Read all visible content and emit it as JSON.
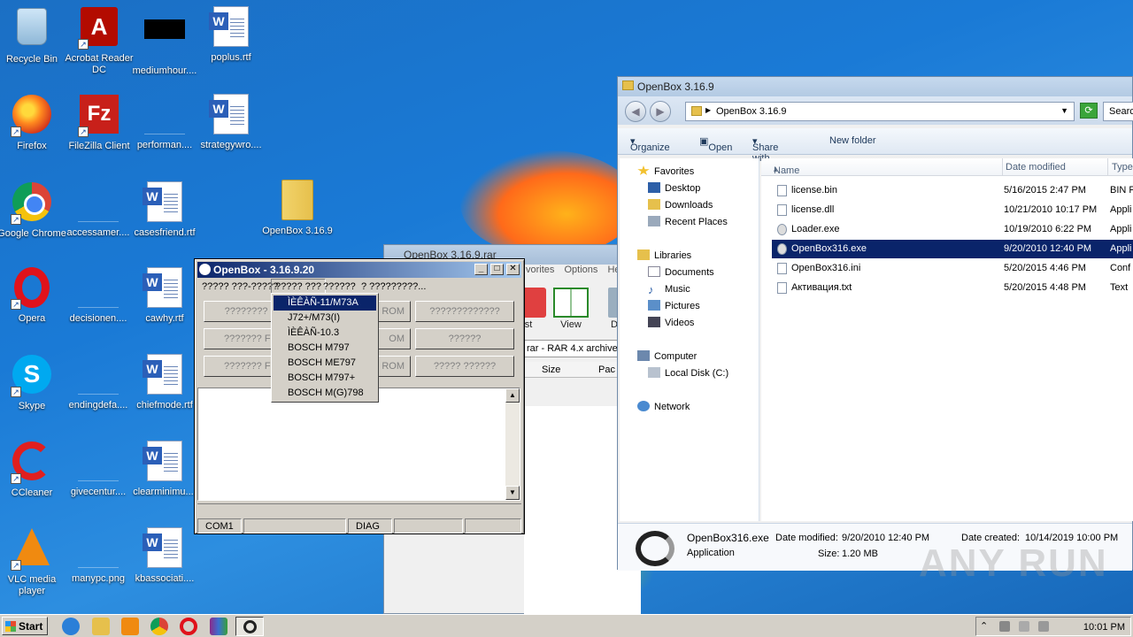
{
  "desktop": {
    "icons": [
      {
        "label": "Recycle Bin",
        "icon": "recycle-bin-icon"
      },
      {
        "label": "Acrobat Reader DC",
        "icon": "acrobat-icon"
      },
      {
        "label": "mediumhour....",
        "icon": "file-icon"
      },
      {
        "label": "poplus.rtf",
        "icon": "word-document-icon"
      },
      {
        "label": "Firefox",
        "icon": "firefox-icon"
      },
      {
        "label": "FileZilla Client",
        "icon": "filezilla-icon"
      },
      {
        "label": "performan....",
        "icon": "file-icon"
      },
      {
        "label": "strategywro....",
        "icon": "word-document-icon"
      },
      {
        "label": "Google Chrome",
        "icon": "chrome-icon"
      },
      {
        "label": "accessamer....",
        "icon": "file-icon"
      },
      {
        "label": "casesfriend.rtf",
        "icon": "word-document-icon"
      },
      {
        "label": "OpenBox 3.16.9",
        "icon": "folder-icon"
      },
      {
        "label": "Opera",
        "icon": "opera-icon"
      },
      {
        "label": "decisionen....",
        "icon": "file-icon"
      },
      {
        "label": "cawhy.rtf",
        "icon": "word-document-icon"
      },
      {
        "label": "Skype",
        "icon": "skype-icon"
      },
      {
        "label": "endingdefa....",
        "icon": "file-icon"
      },
      {
        "label": "chiefmode.rtf",
        "icon": "word-document-icon"
      },
      {
        "label": "CCleaner",
        "icon": "ccleaner-icon"
      },
      {
        "label": "givecentur....",
        "icon": "file-icon"
      },
      {
        "label": "clearminimu....",
        "icon": "word-document-icon"
      },
      {
        "label": "VLC media player",
        "icon": "vlc-icon"
      },
      {
        "label": "manypc.png",
        "icon": "file-icon"
      },
      {
        "label": "kbassociati....",
        "icon": "word-document-icon"
      }
    ]
  },
  "rar": {
    "title": "OpenBox 3.16.9.rar",
    "menu": [
      "vorites",
      "Options",
      "Help"
    ],
    "toolbar": [
      "st",
      "View",
      "De"
    ],
    "address": "rar - RAR 4.x archive",
    "columns": [
      "Size",
      "Pac"
    ]
  },
  "openbox": {
    "title": "OpenBox - 3.16.9.20",
    "menu": [
      "????? ???-?????",
      "????? ???",
      "??????",
      "? ?????????..."
    ],
    "buttons_left": [
      "???????? FL",
      "??????? FLA",
      "??????? FLA"
    ],
    "buttons_mid": [
      "ROM",
      "OM",
      "ROM"
    ],
    "buttons_right": [
      "?????????????",
      "??????",
      "????? ??????"
    ],
    "dropdown": [
      "ÌÈÊÀÑ-11/M73A",
      "J72+/M73(I)",
      "ÌÈÊÀÑ-10.3",
      "BOSCH M797",
      "BOSCH ME797",
      "BOSCH M797+",
      "BOSCH M(G)798"
    ],
    "status": [
      "COM1",
      "",
      "DIAG",
      "",
      ""
    ]
  },
  "explorer": {
    "title": "OpenBox 3.16.9",
    "address": "OpenBox 3.16.9",
    "search": "Searc",
    "commands": [
      "Organize",
      "Open",
      "Share with",
      "New folder"
    ],
    "nav": {
      "favorites": "Favorites",
      "desktop": "Desktop",
      "downloads": "Downloads",
      "recent": "Recent Places",
      "libraries": "Libraries",
      "documents": "Documents",
      "music": "Music",
      "pictures": "Pictures",
      "videos": "Videos",
      "computer": "Computer",
      "localdisk": "Local Disk (C:)",
      "network": "Network"
    },
    "columns": [
      "Name",
      "Date modified",
      "Type"
    ],
    "files": [
      {
        "name": "license.bin",
        "date": "5/16/2015 2:47 PM",
        "type": "BIN F"
      },
      {
        "name": "license.dll",
        "date": "10/21/2010 10:17 PM",
        "type": "Appli"
      },
      {
        "name": "Loader.exe",
        "date": "10/19/2010 6:22 PM",
        "type": "Appli"
      },
      {
        "name": "OpenBox316.exe",
        "date": "9/20/2010 12:40 PM",
        "type": "Appli"
      },
      {
        "name": "OpenBox316.ini",
        "date": "5/20/2015 4:46 PM",
        "type": "Conf"
      },
      {
        "name": "Активация.txt",
        "date": "5/20/2015 4:48 PM",
        "type": "Text"
      }
    ],
    "details": {
      "name": "OpenBox316.exe",
      "kind": "Application",
      "modified_label": "Date modified:",
      "modified": "9/20/2010 12:40 PM",
      "size_label": "Size:",
      "size": "1.20 MB",
      "created_label": "Date created:",
      "created": "10/14/2019 10:00 PM"
    }
  },
  "watermark": "ANY RUN",
  "taskbar": {
    "start": "Start",
    "clock": "10:01 PM"
  }
}
